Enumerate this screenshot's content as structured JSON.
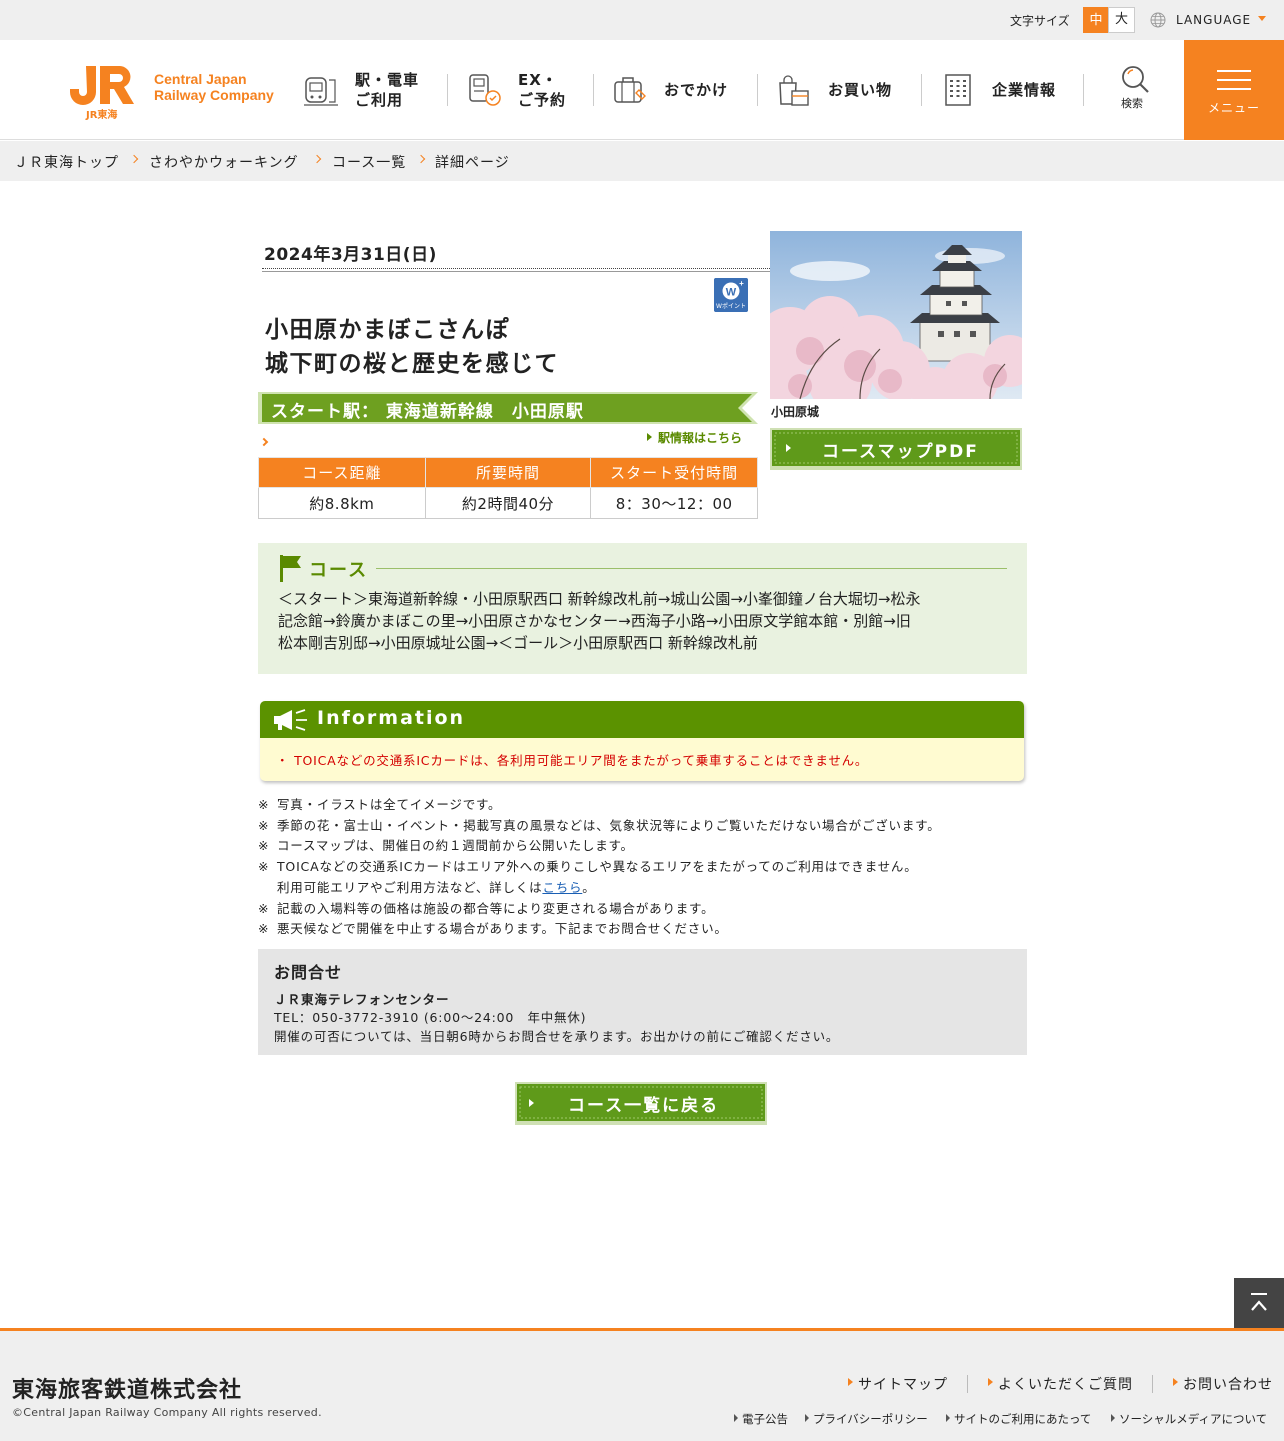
{
  "utility": {
    "font_size_label": "文字サイズ",
    "font_size_medium": "中",
    "font_size_large": "大",
    "language": "LANGUAGE"
  },
  "header": {
    "logo_text_line1": "Central Japan",
    "logo_text_line2": "Railway Company",
    "logo_sub": "JR東海",
    "nav": [
      {
        "line1": "駅・電車",
        "line2": "ご利用"
      },
      {
        "line1": "EX・",
        "line2": "ご予約"
      },
      {
        "line1": "おでかけ",
        "line2": ""
      },
      {
        "line1": "お買い物",
        "line2": ""
      },
      {
        "line1": "企業情報",
        "line2": ""
      }
    ],
    "search_label": "検索",
    "menu_label": "メニュー"
  },
  "breadcrumb": [
    "ＪＲ東海トップ",
    "さわやかウォーキング",
    "コース一覧",
    "詳細ページ"
  ],
  "event": {
    "date": "2024年3月31日(日)",
    "wpoint_label": "Wポイント",
    "title_line1": "小田原かまぼこさんぽ",
    "title_line2": "城下町の桜と歴史を感じて",
    "start_station": "スタート駅：  東海道新幹線　小田原駅",
    "station_info_link": "駅情報はこちら",
    "table_headers": [
      "コース距離",
      "所要時間",
      "スタート受付時間"
    ],
    "table_values": [
      "約8.8km",
      "約2時間40分",
      "8：30～12：00"
    ],
    "photo_caption": "小田原城",
    "course_map_button": "コースマップPDF"
  },
  "course": {
    "heading": "コース",
    "route_line1": "＜スタート＞東海道新幹線・小田原駅西口 新幹線改札前→城山公園→小峯御鐘ノ台大堀切→松永",
    "route_line2": "記念館→鈴廣かまぼこの里→小田原さかなセンター→西海子小路→小田原文学館本館・別館→旧",
    "route_line3": "松本剛吉別邸→小田原城址公園→＜ゴール＞小田原駅西口 新幹線改札前"
  },
  "information": {
    "heading": "Information",
    "item": "・ TOICAなどの交通系ICカードは、各利用可能エリア間をまたがって乗車することはできません。"
  },
  "notes": {
    "mark": "※",
    "n1": "写真・イラストは全てイメージです。",
    "n2": "季節の花・富士山・イベント・掲載写真の風景などは、気象状況等によりご覧いただけない場合がございます。",
    "n3": "コースマップは、開催日の約１週間前から公開いたします。",
    "n4": "TOICAなどの交通系ICカードはエリア外への乗りこしや異なるエリアをまたがってのご利用はできません。",
    "n4b_pre": "利用可能エリアやご利用方法など、詳しくは",
    "n4b_link": "こちら",
    "n4b_post": "。",
    "n5": "記載の入場料等の価格は施設の都合等により変更される場合があります。",
    "n6": "悪天候などで開催を中止する場合があります。下記までお問合せください。"
  },
  "contact": {
    "heading": "お問合せ",
    "org": "ＪＲ東海テレフォンセンター",
    "tel": "TEL：050-3772-3910 (6:00～24:00　年中無休)",
    "note": "開催の可否については、当日朝6時からお問合せを承ります。お出かけの前にご確認ください。"
  },
  "back_button": "コース一覧に戻る",
  "footer": {
    "company": "東海旅客鉄道株式会社",
    "copyright": "©Central Japan Railway Company All rights reserved.",
    "links": [
      "サイトマップ",
      "よくいただくご質問",
      "お問い合わせ"
    ],
    "sublinks": [
      "電子公告",
      "プライバシーポリシー",
      "サイトのご利用にあたって",
      "ソーシャルメディアについて"
    ]
  },
  "colors": {
    "brand_orange": "#f58220",
    "green": "#5b9200",
    "alert_red": "#d40000"
  }
}
